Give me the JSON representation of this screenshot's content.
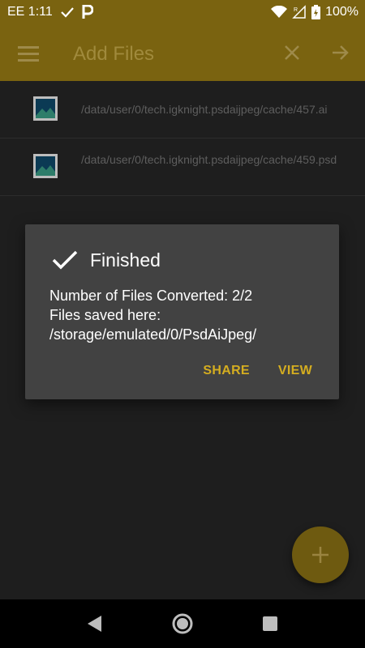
{
  "status_bar": {
    "carrier_time": "EE 1:11",
    "battery": "100%",
    "icons": [
      "check-icon",
      "parking-icon",
      "wifi-icon",
      "signal-r-icon",
      "battery-charging-icon"
    ]
  },
  "app_bar": {
    "title": "Add Files",
    "icons": [
      "menu-icon",
      "close-icon",
      "arrow-forward-icon"
    ]
  },
  "files": [
    {
      "path": "/data/user/0/tech.igknight.psdaijpeg/cache/457.ai",
      "icon": "image-icon"
    },
    {
      "path": "/data/user/0/tech.igknight.psdaijpeg/cache/459.psd",
      "icon": "image-icon"
    }
  ],
  "dialog": {
    "title": "Finished",
    "line1": "Number of Files Converted: 2/2",
    "line2": "Files saved here: /storage/emulated/0/PsdAiJpeg/",
    "share_label": "SHARE",
    "view_label": "VIEW"
  },
  "fab": {
    "icon": "add-icon"
  },
  "colors": {
    "primary": "#7a6310",
    "accent": "#d4ad20",
    "dialog_bg": "#424242",
    "background": "#1e1e1e"
  }
}
